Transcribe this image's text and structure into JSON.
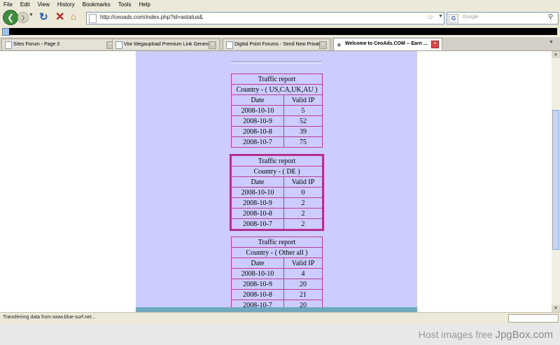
{
  "menu": [
    "File",
    "Edit",
    "View",
    "History",
    "Bookmarks",
    "Tools",
    "Help"
  ],
  "nav": {
    "url": "http://ceoads.com/index.php?id=astatus&",
    "search_placeholder": "Google",
    "search_engine_letter": "G"
  },
  "tabs": [
    {
      "title": "Sites Forum - Page 3",
      "active": false
    },
    {
      "title": "Vior Megaupload Premium Link Generator",
      "active": false
    },
    {
      "title": "Digital Point Forums - Send New Private...",
      "active": false
    },
    {
      "title": "Welcome to CeoAds.COM -- Earn ...",
      "active": true
    }
  ],
  "reports": [
    {
      "title": "Traffic report",
      "country": "Country - ( US,CA,UK,AU )",
      "col_date": "Date",
      "col_valid": "Valid IP",
      "rows": [
        {
          "date": "2008-10-10",
          "valid": "5"
        },
        {
          "date": "2008-10-9",
          "valid": "52"
        },
        {
          "date": "2008-10-8",
          "valid": "39"
        },
        {
          "date": "2008-10-7",
          "valid": "75"
        }
      ]
    },
    {
      "title": "Traffic report",
      "country": "Country - ( DE )",
      "col_date": "Date",
      "col_valid": "Valid IP",
      "rows": [
        {
          "date": "2008-10-10",
          "valid": "0"
        },
        {
          "date": "2008-10-9",
          "valid": "2"
        },
        {
          "date": "2008-10-8",
          "valid": "2"
        },
        {
          "date": "2008-10-7",
          "valid": "2"
        }
      ]
    },
    {
      "title": "Traffic report",
      "country": "Country - ( Other all )",
      "col_date": "Date",
      "col_valid": "Valid IP",
      "rows": [
        {
          "date": "2008-10-10",
          "valid": "4"
        },
        {
          "date": "2008-10-9",
          "valid": "20"
        },
        {
          "date": "2008-10-8",
          "valid": "21"
        },
        {
          "date": "2008-10-7",
          "valid": "20"
        }
      ]
    }
  ],
  "status": {
    "text": "Transferring data from www.blue-surf.net..."
  },
  "footer": {
    "prefix": "Host images free ",
    "brand": "JpgBox.com"
  },
  "colors": {
    "panel_bg": "#ccccff",
    "table_border": "#c0369a",
    "accent_bar": "#6ea9bf"
  }
}
